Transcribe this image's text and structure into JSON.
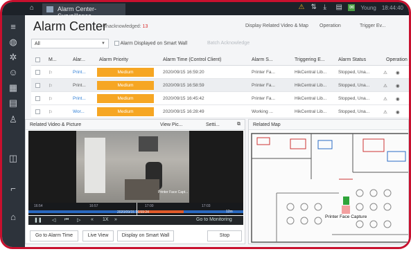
{
  "topbar": {
    "tab_title": "Alarm Center-Surveillance",
    "user": "Young",
    "time": "18:44:40"
  },
  "header": {
    "title": "Alarm Center",
    "unack_label": "Unacknowledged:",
    "unack_count": "13",
    "actions": [
      "Display Related Video & Map",
      "Operation",
      "Trigger Ev..."
    ]
  },
  "filter": {
    "selected": "All",
    "smart_wall_label": "Alarm Displayed on Smart Wall",
    "batch_ack": "Batch Acknowledge"
  },
  "table": {
    "columns": [
      "M...",
      "Alar...",
      "Alarm Priority",
      "Alarm Time (Control Client)",
      "Alarm S...",
      "Triggering E...",
      "Alarm Status",
      "Operation"
    ],
    "rows": [
      {
        "alarm": "Print...",
        "priority": "Medium",
        "time": "2020/09/15 16:59:20",
        "source": "Printer Fa...",
        "trigger": "HikCentral Lib...",
        "status": "Stopped, Una..."
      },
      {
        "alarm": "Print...",
        "priority": "Medium",
        "time": "2020/09/15 16:58:59",
        "source": "Printer Fa...",
        "trigger": "HikCentral Lib...",
        "status": "Stopped, Una..."
      },
      {
        "alarm": "Print...",
        "priority": "Medium",
        "time": "2020/09/15 16:45:42",
        "source": "Printer Fa...",
        "trigger": "HikCentral Lib...",
        "status": "Stopped, Una..."
      },
      {
        "alarm": "Wor...",
        "priority": "Medium",
        "time": "2020/09/15 16:28:49",
        "source": "Working ...",
        "trigger": "HikCentral Lib...",
        "status": "Stopped, Una..."
      }
    ]
  },
  "video_panel": {
    "title": "Related Video & Picture",
    "view_pic": "View Pic...",
    "settings": "Setti...",
    "overlay_text": "Printer Face Capt...",
    "timeline_ticks": [
      "16:54",
      "16:57",
      "17:00",
      "17:03"
    ],
    "timestamp": "2020/09/15 16:59:24",
    "zoom": "12m",
    "speed": "1X",
    "goto_monitoring": "Go to Monitoring",
    "buttons": [
      "Go to Alarm Time",
      "Live View",
      "Display on Smart Wall",
      "Stop"
    ]
  },
  "map_panel": {
    "title": "Related Map",
    "marker_label": "Printer Face Capture"
  },
  "colors": {
    "frame": "#c8102e",
    "priority": "#f6a623",
    "link": "#2f7fd6"
  }
}
